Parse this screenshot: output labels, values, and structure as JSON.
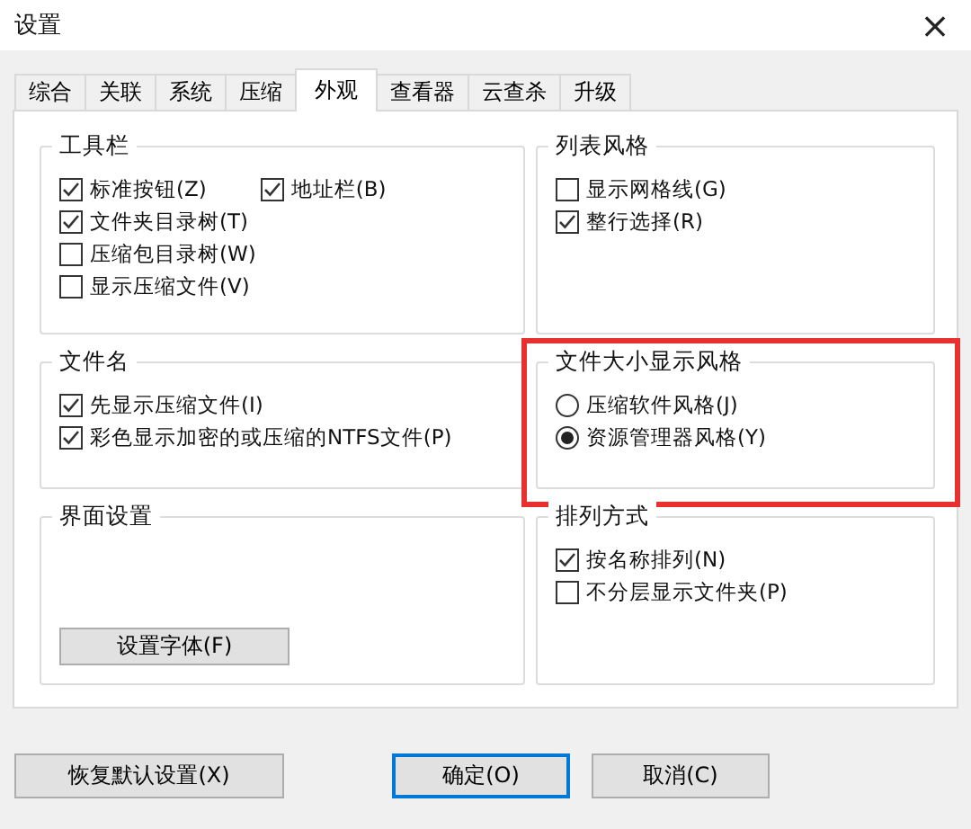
{
  "window": {
    "title": "设置",
    "close": "×"
  },
  "tabs": [
    {
      "label": "综合",
      "selected": false
    },
    {
      "label": "关联",
      "selected": false
    },
    {
      "label": "系统",
      "selected": false
    },
    {
      "label": "压缩",
      "selected": false
    },
    {
      "label": "外观",
      "selected": true
    },
    {
      "label": "查看器",
      "selected": false
    },
    {
      "label": "云查杀",
      "selected": false
    },
    {
      "label": "升级",
      "selected": false
    }
  ],
  "groups": [
    {
      "title": "工具栏",
      "highlighted": false,
      "rows": [
        [
          {
            "kind": "checkbox",
            "label": "标准按钮(Z)",
            "checked": true
          },
          {
            "kind": "checkbox",
            "label": "地址栏(B)",
            "checked": true
          }
        ],
        [
          {
            "kind": "checkbox",
            "label": "文件夹目录树(T)",
            "checked": true
          }
        ],
        [
          {
            "kind": "checkbox",
            "label": "压缩包目录树(W)",
            "checked": false
          }
        ],
        [
          {
            "kind": "checkbox",
            "label": "显示压缩文件(V)",
            "checked": false
          }
        ]
      ]
    },
    {
      "title": "列表风格",
      "highlighted": false,
      "rows": [
        [
          {
            "kind": "checkbox",
            "label": "显示网格线(G)",
            "checked": false
          }
        ],
        [
          {
            "kind": "checkbox",
            "label": "整行选择(R)",
            "checked": true
          }
        ]
      ]
    },
    {
      "title": "文件名",
      "highlighted": false,
      "rows": [
        [
          {
            "kind": "checkbox",
            "label": "先显示压缩文件(I)",
            "checked": true
          }
        ],
        [
          {
            "kind": "checkbox",
            "label": "彩色显示加密的或压缩的NTFS文件(P)",
            "checked": true
          }
        ]
      ]
    },
    {
      "title": "文件大小显示风格",
      "highlighted": true,
      "rows": [
        [
          {
            "kind": "radio",
            "label": "压缩软件风格(J)",
            "selected": false
          }
        ],
        [
          {
            "kind": "radio",
            "label": "资源管理器风格(Y)",
            "selected": true
          }
        ]
      ]
    },
    {
      "title": "界面设置",
      "highlighted": false,
      "rows": [
        [
          {
            "kind": "button",
            "label": "设置字体(F)"
          }
        ]
      ]
    },
    {
      "title": "排列方式",
      "highlighted": false,
      "rows": [
        [
          {
            "kind": "checkbox",
            "label": "按名称排列(N)",
            "checked": true
          }
        ],
        [
          {
            "kind": "checkbox",
            "label": "不分层显示文件夹(P)",
            "checked": false
          }
        ]
      ]
    }
  ],
  "buttons": [
    {
      "label": "恢复默认设置(X)",
      "default": false
    },
    {
      "label": "确定(O)",
      "default": true
    },
    {
      "label": "取消(C)",
      "default": false
    }
  ]
}
